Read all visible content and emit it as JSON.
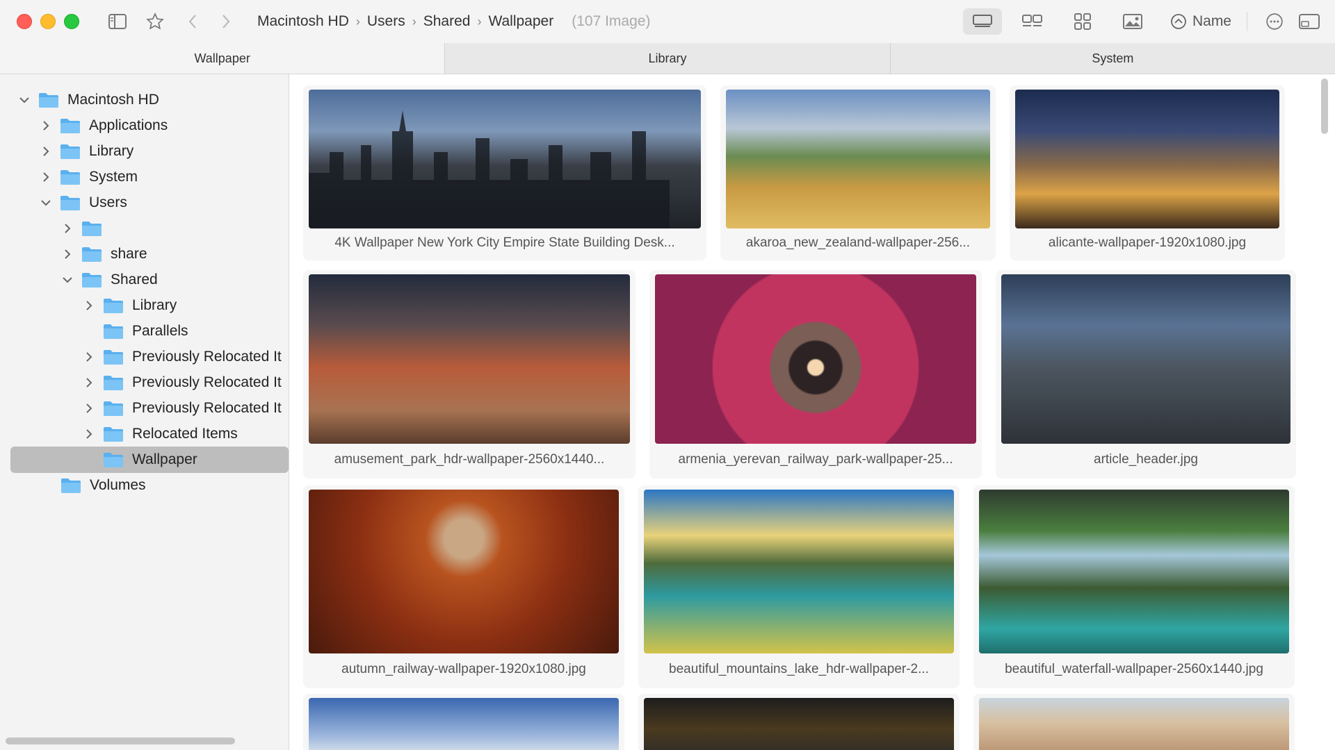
{
  "window": {
    "breadcrumb": [
      "Macintosh HD",
      "Users",
      "Shared",
      "Wallpaper"
    ],
    "item_count": "(107 Image)",
    "sort_label": "Name"
  },
  "tabs": [
    "Wallpaper",
    "Library",
    "System"
  ],
  "sidebar": {
    "items": [
      {
        "label": "Macintosh HD"
      },
      {
        "label": "Applications"
      },
      {
        "label": "Library"
      },
      {
        "label": "System"
      },
      {
        "label": "Users"
      },
      {
        "label": ""
      },
      {
        "label": "share"
      },
      {
        "label": "Shared"
      },
      {
        "label": "Library"
      },
      {
        "label": "Parallels"
      },
      {
        "label": "Previously Relocated It"
      },
      {
        "label": "Previously Relocated It"
      },
      {
        "label": "Previously Relocated It"
      },
      {
        "label": "Relocated Items"
      },
      {
        "label": "Wallpaper"
      },
      {
        "label": "Volumes"
      }
    ]
  },
  "images": [
    {
      "caption": "4K Wallpaper   New York City Empire State Building Desk..."
    },
    {
      "caption": "akaroa_new_zealand-wallpaper-256..."
    },
    {
      "caption": "alicante-wallpaper-1920x1080.jpg"
    },
    {
      "caption": "amusement_park_hdr-wallpaper-2560x1440..."
    },
    {
      "caption": "armenia_yerevan_railway_park-wallpaper-25..."
    },
    {
      "caption": "article_header.jpg"
    },
    {
      "caption": "autumn_railway-wallpaper-1920x1080.jpg"
    },
    {
      "caption": "beautiful_mountains_lake_hdr-wallpaper-2..."
    },
    {
      "caption": "beautiful_waterfall-wallpaper-2560x1440.jpg"
    }
  ]
}
